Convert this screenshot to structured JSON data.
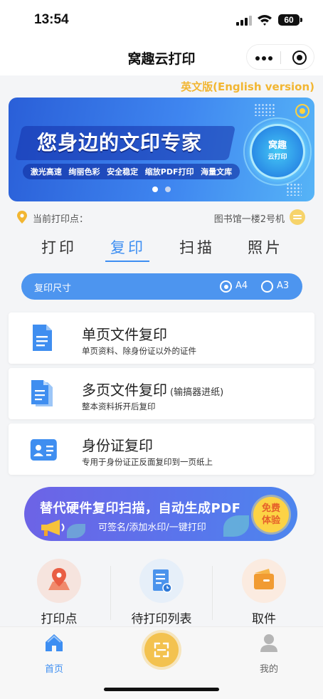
{
  "status_bar": {
    "time": "13:54",
    "battery": "60",
    "signal_icon": "signal-icon",
    "wifi_icon": "wifi-icon"
  },
  "nav": {
    "title": "窝趣云打印",
    "more_icon": "more-icon",
    "close_icon": "mini-program-close-icon"
  },
  "english_link": "英文版(English version)",
  "banner": {
    "headline": "您身边的文印专家",
    "features": [
      "激光高速",
      "绚丽色彩",
      "安全稳定",
      "缩放PDF打印",
      "海量文库"
    ],
    "logo_title": "窝趣",
    "logo_sub": "云打印",
    "active_slide": 0,
    "slide_count": 2,
    "colors": {
      "accent": "#3d8ef2",
      "dot_active": "#ffffff",
      "dot_inactive": "#c8d6f0"
    }
  },
  "location": {
    "label": "当前打印点：",
    "value": "图书馆一楼2号机",
    "pin_icon": "location-pin-icon",
    "switch_icon": "switch-location-icon"
  },
  "tabs": [
    {
      "label": "打印",
      "active": false
    },
    {
      "label": "复印",
      "active": true
    },
    {
      "label": "扫描",
      "active": false
    },
    {
      "label": "照片",
      "active": false
    }
  ],
  "copy_size": {
    "label": "复印尺寸",
    "options": [
      "A4",
      "A3"
    ],
    "selected": "A4"
  },
  "options": [
    {
      "title": "单页文件复印",
      "note": "",
      "desc": "单页资料、除身份证以外的证件",
      "icon": "single-page-doc-icon"
    },
    {
      "title": "多页文件复印",
      "note": "(输搞器进纸)",
      "desc": "整本资料拆开后复印",
      "icon": "multi-page-doc-icon"
    },
    {
      "title": "身份证复印",
      "note": "",
      "desc": "专用于身份证正反面复印到一页纸上",
      "icon": "id-card-icon"
    }
  ],
  "promo": {
    "title": "替代硬件复印扫描，自动生成PDF",
    "subtitle": "可签名/添加水印/一键打印",
    "badge": [
      "免费",
      "体验"
    ],
    "icon": "megaphone-icon"
  },
  "quick_entries": [
    {
      "label": "打印点",
      "icon": "map-location-icon",
      "color": "#f3e1dc"
    },
    {
      "label": "待打印列表",
      "icon": "print-queue-icon",
      "color": "#e4eef9"
    },
    {
      "label": "取件",
      "icon": "wallet-pickup-icon",
      "color": "#fbeadf"
    }
  ],
  "tabbar": {
    "home": {
      "label": "首页",
      "icon": "home-icon",
      "color": "#3d8ef2"
    },
    "scan": {
      "icon": "scan-icon"
    },
    "mine": {
      "label": "我的",
      "icon": "user-icon",
      "color": "#666666"
    }
  }
}
